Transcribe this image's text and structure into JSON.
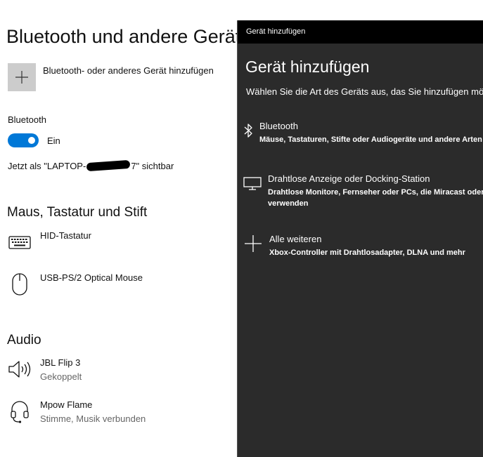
{
  "settings": {
    "title": "Bluetooth und andere Geräte",
    "add_device_label": "Bluetooth- oder anderes Gerät hinzufügen",
    "bluetooth_label": "Bluetooth",
    "toggle_state": "Ein",
    "visible_prefix": "Jetzt als \"LAPTOP-",
    "visible_suffix": "7\" sichtbar",
    "sections": {
      "input": {
        "title": "Maus, Tastatur und Stift",
        "devices": [
          {
            "name": "HID-Tastatur",
            "icon": "keyboard-icon"
          },
          {
            "name": "USB-PS/2 Optical Mouse",
            "icon": "mouse-icon"
          }
        ]
      },
      "audio": {
        "title": "Audio",
        "devices": [
          {
            "name": "JBL Flip 3",
            "status": "Gekoppelt",
            "icon": "speaker-icon"
          },
          {
            "name": "Mpow Flame",
            "status": "Stimme, Musik verbunden",
            "icon": "headset-icon"
          }
        ]
      }
    }
  },
  "dialog": {
    "window_title": "Gerät hinzufügen",
    "heading": "Gerät hinzufügen",
    "subtitle": "Wählen Sie die Art des Geräts aus, das Sie hinzufügen möchten.",
    "options": [
      {
        "name": "Bluetooth",
        "desc_line1": "Mäuse, Tastaturen, Stifte oder Audiogeräte und andere Arten von Bluetooth-Geräten",
        "icon": "bluetooth-icon"
      },
      {
        "name": "Drahtlose Anzeige oder Docking-Station",
        "desc_line1": "Drahtlose Monitore, Fernseher oder PCs, die Miracast oder kabellose Docks",
        "desc_line2": "verwenden",
        "icon": "monitor-icon"
      },
      {
        "name": "Alle weiteren",
        "desc_line1": "Xbox-Controller mit Drahtlosadapter, DLNA und mehr",
        "icon": "plus-icon"
      }
    ]
  },
  "colors": {
    "accent": "#0078d7",
    "dialog_bg": "#2b2b2b",
    "titlebar_bg": "#000000",
    "tile_bg": "#cccccc"
  }
}
